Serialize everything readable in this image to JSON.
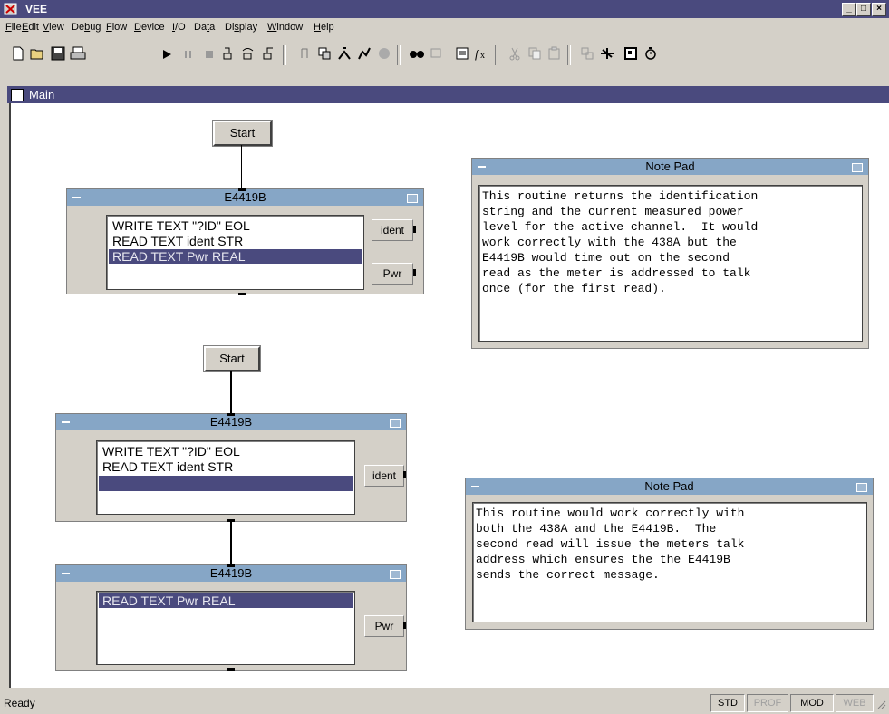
{
  "window": {
    "title": "VEE"
  },
  "menu": [
    "File",
    "Edit",
    "View",
    "Debug",
    "Flow",
    "Device",
    "I/O",
    "Data",
    "Display",
    "Window",
    "Help"
  ],
  "menu_mnemonics": [
    "F",
    "E",
    "V",
    "b",
    "F",
    "D",
    "I",
    "t",
    "s",
    "W",
    "H"
  ],
  "toolbar": {
    "icons": [
      "new-icon",
      "open-icon",
      "save-icon",
      "print-icon",
      "run-icon",
      "pause-icon",
      "stop-icon",
      "step-into-icon",
      "step-over-icon",
      "step-out-icon",
      "breakpoint-icon",
      "copy-object-icon",
      "line-probe-icon",
      "activity-trace-icon",
      "show-data-flow-icon",
      "find-icon",
      "zoom-icon",
      "properties-icon",
      "function-icon",
      "cut-icon",
      "copy-icon",
      "paste-icon",
      "clone-icon",
      "instrument-manager-icon",
      "panel-icon",
      "timer-icon"
    ]
  },
  "main_window": {
    "title": "Main"
  },
  "start_buttons": [
    "Start",
    "Start"
  ],
  "objects": [
    {
      "title": "E4419B",
      "lines": [
        "WRITE TEXT \"?ID\" EOL",
        "READ TEXT ident STR",
        "READ TEXT Pwr REAL"
      ],
      "selected": 2,
      "outputs": [
        "ident",
        "Pwr"
      ]
    },
    {
      "title": "E4419B",
      "lines": [
        "WRITE TEXT \"?ID\" EOL",
        "READ TEXT ident STR",
        ""
      ],
      "selected": 2,
      "outputs": [
        "ident"
      ]
    },
    {
      "title": "E4419B",
      "lines": [
        "READ TEXT Pwr REAL"
      ],
      "selected": 0,
      "outputs": [
        "Pwr"
      ]
    }
  ],
  "notepads": [
    {
      "title": "Note Pad",
      "text": "This routine returns the identification\nstring and the current measured power\nlevel for the active channel.  It would\nwork correctly with the 438A but the\nE4419B would time out on the second\nread as the meter is addressed to talk\nonce (for the first read)."
    },
    {
      "title": "Note Pad",
      "text": "This routine would work correctly with\nboth the 438A and the E4419B.  The\nsecond read will issue the meters talk\naddress which ensures the the E4419B\nsends the correct message."
    }
  ],
  "status": {
    "text": "Ready",
    "indicators": [
      {
        "label": "STD",
        "enabled": true
      },
      {
        "label": "PROF",
        "enabled": false
      },
      {
        "label": "MOD",
        "enabled": true
      },
      {
        "label": "WEB",
        "enabled": false
      }
    ]
  },
  "colors": {
    "title_bar": "#4a4a7e",
    "object_title": "#86a6c6",
    "selection": "#4a4a7e",
    "workspace": "#ffffff",
    "chrome": "#d4d0c8"
  }
}
